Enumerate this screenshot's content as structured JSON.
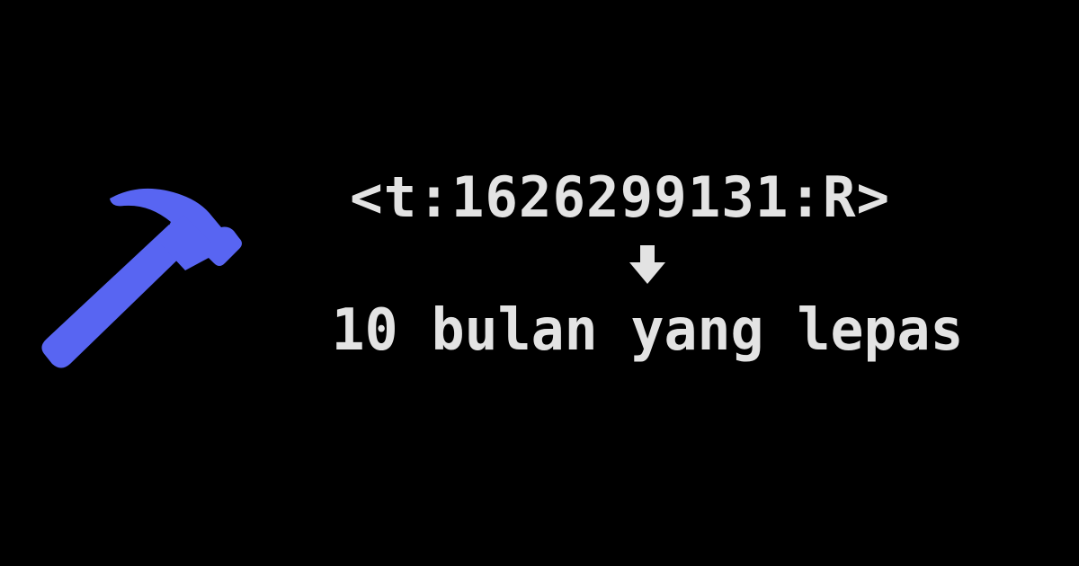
{
  "timestamp_code": "<t:1626299131:R>",
  "result_text": "10 bulan yang lepas",
  "colors": {
    "background": "#000000",
    "text": "#e3e3e3",
    "hammer": "#5865f2"
  },
  "icons": {
    "tool": "hammer-icon",
    "arrow": "down-arrow-icon"
  }
}
